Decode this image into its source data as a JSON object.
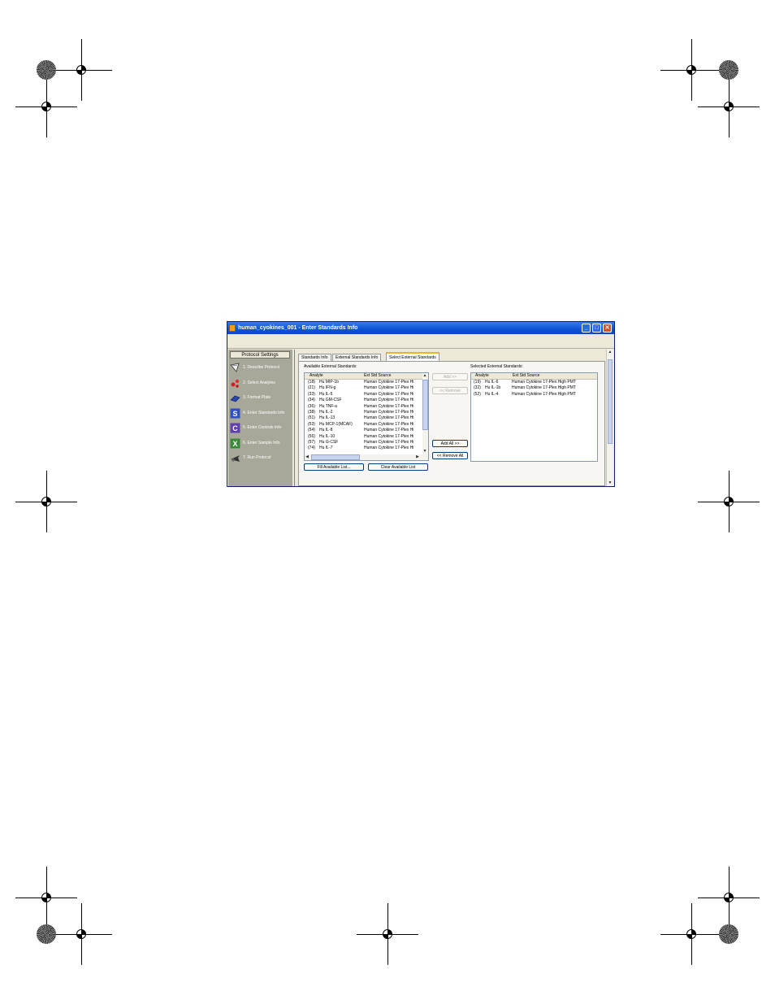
{
  "window": {
    "title": "human_cyokines_001 - Enter Standards Info",
    "controls": {
      "minimize": "_",
      "maximize": "□",
      "close": "✕"
    }
  },
  "sidebar": {
    "header": "Protocol Settings",
    "items": [
      {
        "label": "1. Describe Protocol",
        "icon": "describe-protocol-icon"
      },
      {
        "label": "2. Select Analytes",
        "icon": "select-analytes-icon"
      },
      {
        "label": "3. Format Plate",
        "icon": "format-plate-icon"
      },
      {
        "label": "4. Enter Standards Info",
        "icon": "standards-icon"
      },
      {
        "label": "5. Enter Controls Info",
        "icon": "controls-icon"
      },
      {
        "label": "6. Enter Sample Info",
        "icon": "sample-icon"
      },
      {
        "label": "7. Run Protocol",
        "icon": "run-protocol-icon"
      }
    ]
  },
  "tabs": [
    {
      "label": "Standards Info"
    },
    {
      "label": "External Standards Info"
    },
    {
      "label": "Select External Standards"
    }
  ],
  "available": {
    "caption": "Available External Standards:",
    "columns": [
      "Analyte",
      "Ext Std Source"
    ],
    "rows": [
      {
        "id": "(18)",
        "name": "Hu MIP-1b",
        "source": "Human Cytokine 17-Plex Hi"
      },
      {
        "id": "(21)",
        "name": "Hu IFN-g",
        "source": "Human Cytokine 17-Plex Hi"
      },
      {
        "id": "(33)",
        "name": "Hu IL-5",
        "source": "Human Cytokine 17-Plex Hi"
      },
      {
        "id": "(34)",
        "name": "Hu GM-CSF",
        "source": "Human Cytokine 17-Plex Hi"
      },
      {
        "id": "(36)",
        "name": "Hu TNF-a",
        "source": "Human Cytokine 17-Plex Hi"
      },
      {
        "id": "(38)",
        "name": "Hu IL-2",
        "source": "Human Cytokine 17-Plex Hi"
      },
      {
        "id": "(51)",
        "name": "Hu IL-13",
        "source": "Human Cytokine 17-Plex Hi"
      },
      {
        "id": "(53)",
        "name": "Hu MCP-1(MCAF)",
        "source": "Human Cytokine 17-Plex Hi"
      },
      {
        "id": "(54)",
        "name": "Hu IL-8",
        "source": "Human Cytokine 17-Plex Hi"
      },
      {
        "id": "(56)",
        "name": "Hu IL-10",
        "source": "Human Cytokine 17-Plex Hi"
      },
      {
        "id": "(57)",
        "name": "Hu G-CSF",
        "source": "Human Cytokine 17-Plex Hi"
      },
      {
        "id": "(74)",
        "name": "Hu IL-7",
        "source": "Human Cytokine 17-Plex Hi"
      }
    ]
  },
  "buttons": {
    "add": "Add >>",
    "remove": "<< Remove",
    "add_all": "Add All >>",
    "remove_all": "<< Remove All",
    "fill_list": "Fill Available List...",
    "clear_list": "Clear Available List"
  },
  "selected": {
    "caption": "Selected External Standards:",
    "columns": [
      "Analyte",
      "Ext Std Source"
    ],
    "rows": [
      {
        "id": "(19)",
        "name": "Hu IL-6",
        "source": "Human Cytokine 17-Plex High PMT"
      },
      {
        "id": "(32)",
        "name": "Hu IL-1b",
        "source": "Human Cytokine 17-Plex High PMT"
      },
      {
        "id": "(52)",
        "name": "Hu IL-4",
        "source": "Human Cytokine 17-Plex High PMT"
      }
    ]
  },
  "colors": {
    "titlebar": "#0a54d4",
    "sidebar": "#a8a89a",
    "active_tab_accent": "#f0b030"
  }
}
